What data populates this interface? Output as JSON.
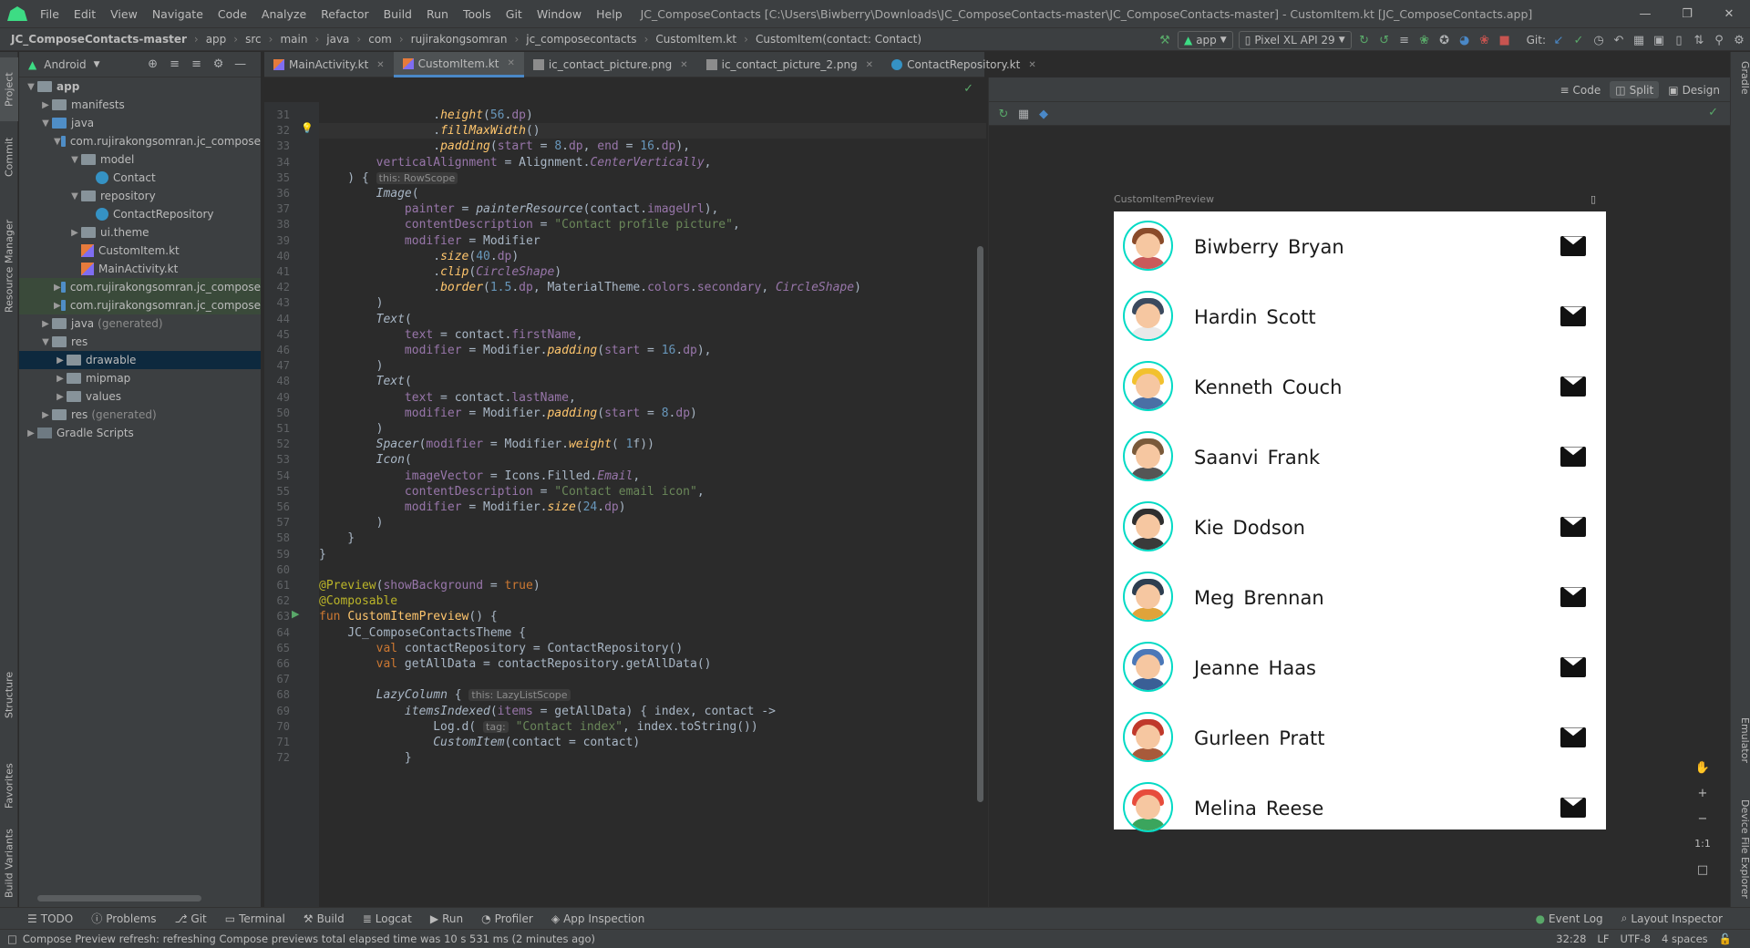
{
  "window": {
    "title": "JC_ComposeContacts [C:\\Users\\Biwberry\\Downloads\\JC_ComposeContacts-master\\JC_ComposeContacts-master] - CustomItem.kt [JC_ComposeContacts.app]",
    "menu": [
      "File",
      "Edit",
      "View",
      "Navigate",
      "Code",
      "Analyze",
      "Refactor",
      "Build",
      "Run",
      "Tools",
      "Git",
      "Window",
      "Help"
    ]
  },
  "breadcrumb": [
    "JC_ComposeContacts-master",
    "app",
    "src",
    "main",
    "java",
    "com",
    "rujirakongsomran",
    "jc_composecontacts",
    "CustomItem.kt",
    "CustomItem(contact: Contact)"
  ],
  "toolbar": {
    "run_config": "app",
    "device": "Pixel XL API 29",
    "git_label": "Git:"
  },
  "left_strip": {
    "project": "Project",
    "commit": "Commit",
    "resource_manager": "Resource Manager",
    "structure": "Structure",
    "favorites": "Favorites",
    "build_variants": "Build Variants"
  },
  "right_strip": {
    "gradle": "Gradle",
    "emulator": "Emulator",
    "device_file_explorer": "Device File Explorer"
  },
  "project_panel": {
    "view_mode": "Android",
    "tree": [
      {
        "label": "app",
        "depth": 0,
        "kind": "folder",
        "bold": true
      },
      {
        "label": "manifests",
        "depth": 1,
        "kind": "folder"
      },
      {
        "label": "java",
        "depth": 1,
        "kind": "folder"
      },
      {
        "label": "com.rujirakongsomran.jc_compose",
        "depth": 2,
        "kind": "folder"
      },
      {
        "label": "model",
        "depth": 3,
        "kind": "folder"
      },
      {
        "label": "Contact",
        "depth": 4,
        "kind": "class"
      },
      {
        "label": "repository",
        "depth": 3,
        "kind": "folder"
      },
      {
        "label": "ContactRepository",
        "depth": 4,
        "kind": "class"
      },
      {
        "label": "ui.theme",
        "depth": 3,
        "kind": "folder"
      },
      {
        "label": "CustomItem.kt",
        "depth": 3,
        "kind": "kt"
      },
      {
        "label": "MainActivity.kt",
        "depth": 3,
        "kind": "kt"
      },
      {
        "label": "com.rujirakongsomran.jc_compose",
        "depth": 2,
        "kind": "folder"
      },
      {
        "label": "com.rujirakongsomran.jc_compose",
        "depth": 2,
        "kind": "folder"
      },
      {
        "label": "java",
        "suffix": "(generated)",
        "depth": 1,
        "kind": "folder"
      },
      {
        "label": "res",
        "depth": 1,
        "kind": "folder"
      },
      {
        "label": "drawable",
        "depth": 2,
        "kind": "folder"
      },
      {
        "label": "mipmap",
        "depth": 2,
        "kind": "folder"
      },
      {
        "label": "values",
        "depth": 2,
        "kind": "folder"
      },
      {
        "label": "res",
        "suffix": "(generated)",
        "depth": 1,
        "kind": "folder"
      },
      {
        "label": "Gradle Scripts",
        "depth": 0,
        "kind": "gradle"
      }
    ]
  },
  "editor_tabs": [
    "MainActivity.kt",
    "CustomItem.kt",
    "ic_contact_picture.png",
    "ic_contact_picture_2.png",
    "ContactRepository.kt"
  ],
  "editor": {
    "first_line": 31,
    "current_line": 32,
    "lines": [
      "                .height(56.dp)",
      "                .fillMaxWidth()",
      "                .padding(start = 8.dp, end = 16.dp),",
      "        verticalAlignment = Alignment.CenterVertically,",
      "    ) {",
      "        Image(",
      "            painter = painterResource(contact.imageUrl),",
      "            contentDescription = \"Contact profile picture\",",
      "            modifier = Modifier",
      "                .size(40.dp)",
      "                .clip(CircleShape)",
      "                .border(1.5.dp, MaterialTheme.colors.secondary, CircleShape)",
      "        )",
      "        Text(",
      "            text = contact.firstName,",
      "            modifier = Modifier.padding(start = 16.dp),",
      "        )",
      "        Text(",
      "            text = contact.lastName,",
      "            modifier = Modifier.padding(start = 8.dp)",
      "        )",
      "        Spacer(modifier = Modifier.weight( 1f))",
      "        Icon(",
      "            imageVector = Icons.Filled.Email,",
      "            contentDescription = \"Contact email icon\",",
      "            modifier = Modifier.size(24.dp)",
      "        )",
      "    }",
      "}",
      "",
      "@Preview(showBackground = true)",
      "@Composable",
      "fun CustomItemPreview() {",
      "    JC_ComposeContactsTheme {",
      "        val contactRepository = ContactRepository()",
      "        val getAllData = contactRepository.getAllData()",
      "",
      "        LazyColumn {",
      "            itemsIndexed(items = getAllData) { index, contact ->",
      "                Log.d( \"Contact index\", index.toString())",
      "                CustomItem(contact = contact)",
      "            }"
    ],
    "hints": {
      "rowscope": "this: RowScope",
      "weight": "weight:",
      "tag": "tag:",
      "lazylist": "this: LazyListScope"
    }
  },
  "preview": {
    "modes": [
      "Code",
      "Split",
      "Design"
    ],
    "active_mode": "Split",
    "label": "CustomItemPreview",
    "contacts": [
      {
        "first": "Biwberry",
        "last": "Bryan",
        "hair": "#8a4b2a",
        "body": "#c95a5a"
      },
      {
        "first": "Hardin",
        "last": "Scott",
        "hair": "#3b4a5e",
        "body": "#e9e9e9"
      },
      {
        "first": "Kenneth",
        "last": "Couch",
        "hair": "#f2c12e",
        "body": "#4a6fa5"
      },
      {
        "first": "Saanvi",
        "last": "Frank",
        "hair": "#7a5a3a",
        "body": "#555555"
      },
      {
        "first": "Kie",
        "last": "Dodson",
        "hair": "#2f2f2f",
        "body": "#3a3a3a"
      },
      {
        "first": "Meg",
        "last": "Brennan",
        "hair": "#2d3e50",
        "body": "#e0a33a"
      },
      {
        "first": "Jeanne",
        "last": "Haas",
        "hair": "#4b78b8",
        "body": "#3a5f96"
      },
      {
        "first": "Gurleen",
        "last": "Pratt",
        "hair": "#c0392b",
        "body": "#a85a3a"
      },
      {
        "first": "Melina",
        "last": "Reese",
        "hair": "#e74c3c",
        "body": "#3ba55d"
      }
    ],
    "accent": "#03dac5",
    "zoom_reset": "1:1"
  },
  "bottom_tools": [
    "TODO",
    "Problems",
    "Git",
    "Terminal",
    "Build",
    "Logcat",
    "Run",
    "Profiler",
    "App Inspection"
  ],
  "bottom_right_tools": [
    "Event Log",
    "Layout Inspector"
  ],
  "status": {
    "message": "Compose Preview refresh: refreshing Compose previews total elapsed time was 10 s 531 ms (2 minutes ago)",
    "position": "32:28",
    "line_sep": "LF",
    "encoding": "UTF-8",
    "indent": "4 spaces"
  }
}
